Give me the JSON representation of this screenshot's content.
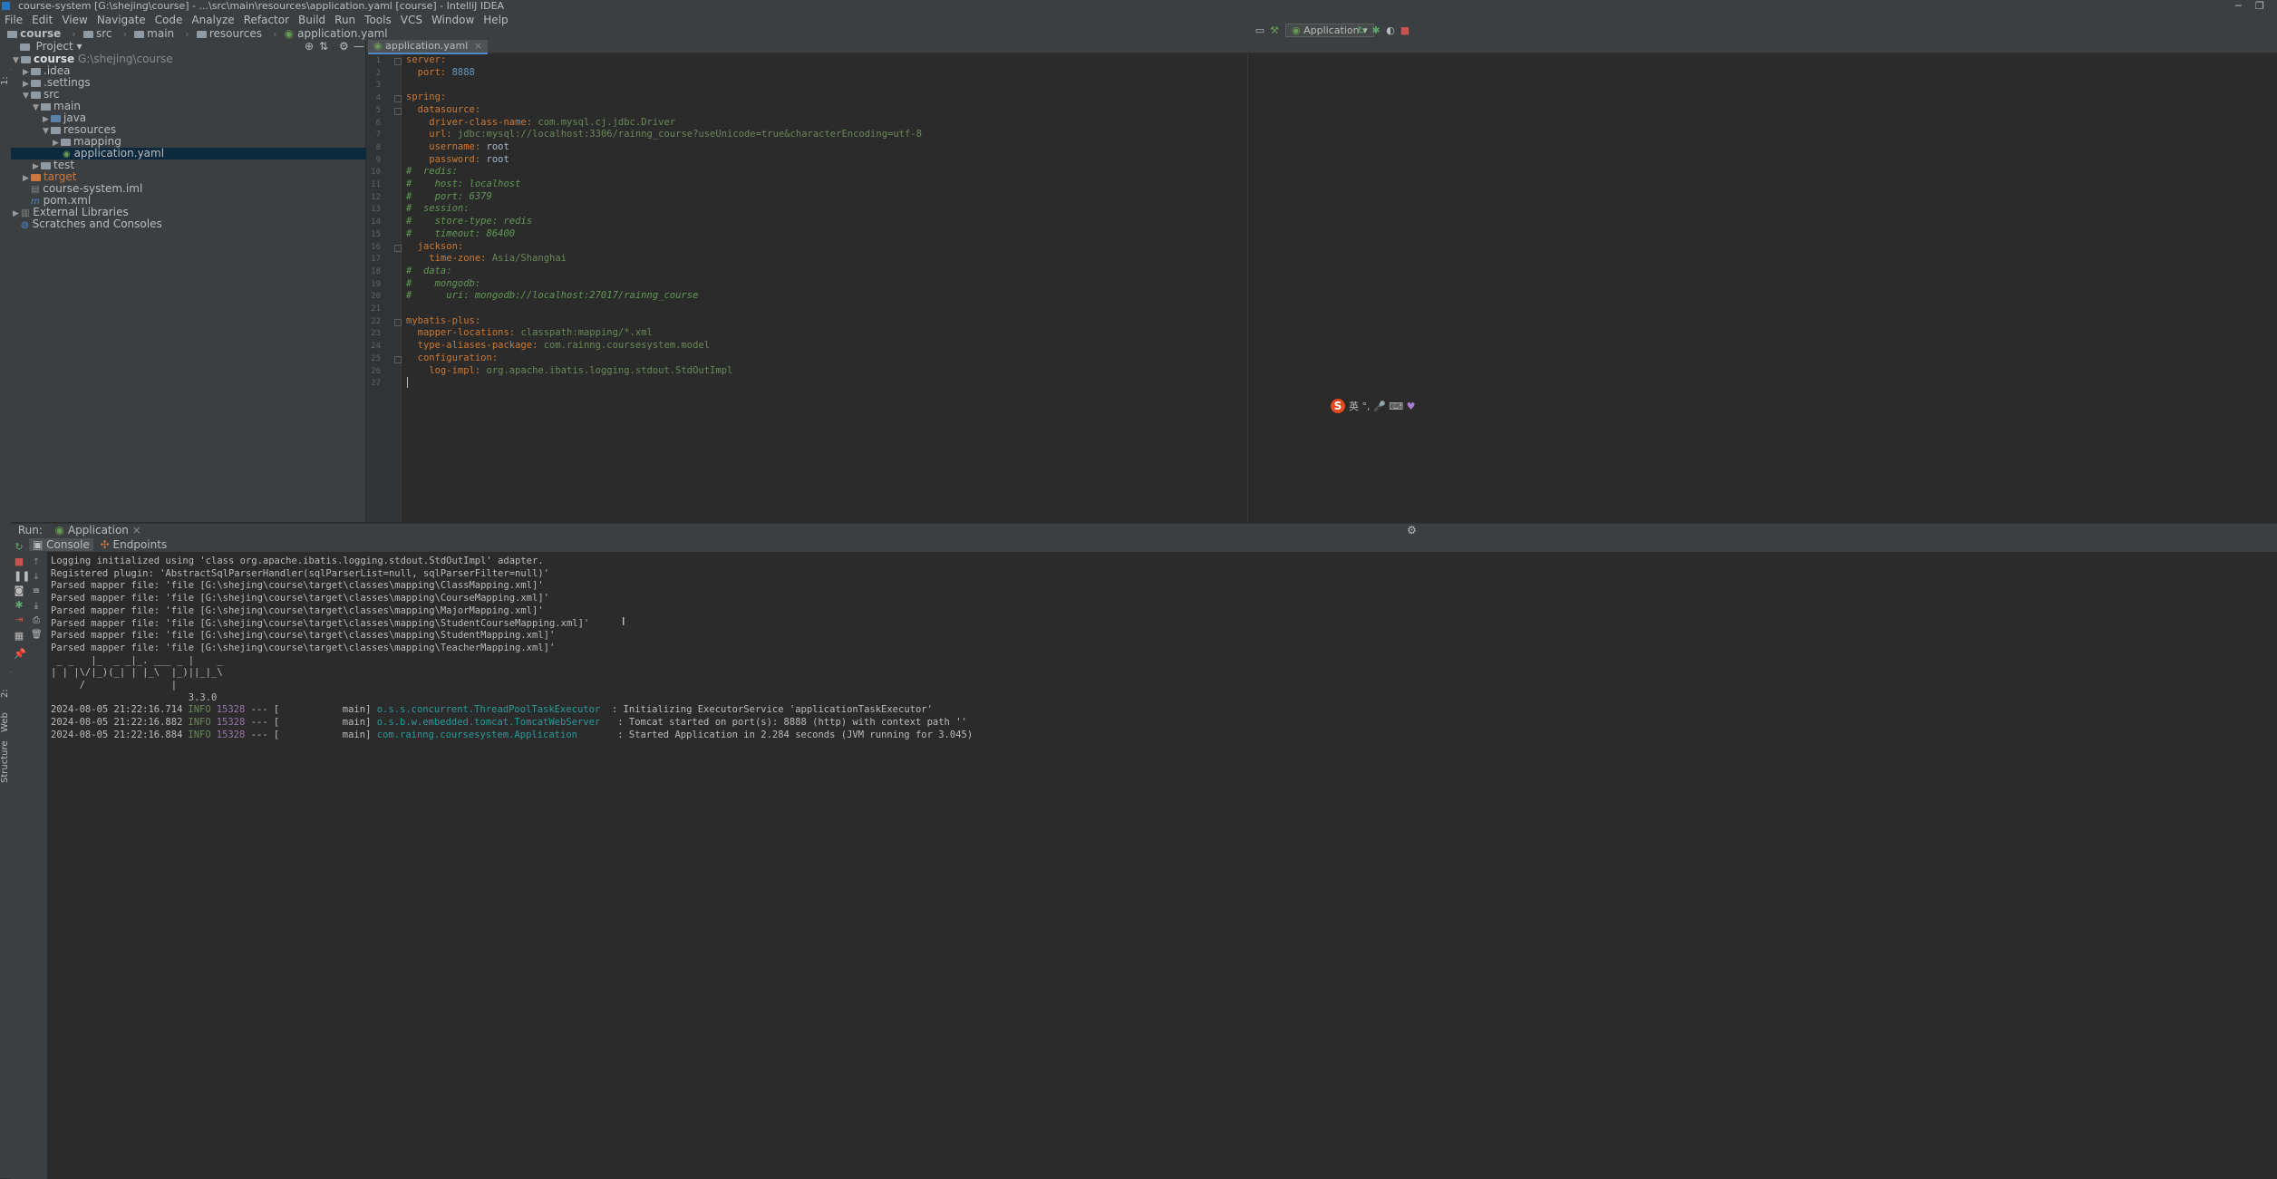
{
  "window": {
    "title": "course-system [G:\\shejing\\course] - ...\\src\\main\\resources\\application.yaml [course] - IntelliJ IDEA"
  },
  "menu": [
    "File",
    "Edit",
    "View",
    "Navigate",
    "Code",
    "Analyze",
    "Refactor",
    "Build",
    "Run",
    "Tools",
    "VCS",
    "Window",
    "Help"
  ],
  "breadcrumb": [
    "course",
    "src",
    "main",
    "resources",
    "application.yaml"
  ],
  "toolbar": {
    "run_config": "Application"
  },
  "side_tabs": {
    "project": "1: Project",
    "favorites": "2: Favorites",
    "web": "Web",
    "structure": "Structure"
  },
  "project": {
    "header": "Project",
    "tree": [
      {
        "label": "course",
        "extra": "G:\\shejing\\course"
      },
      {
        "label": ".idea"
      },
      {
        "label": ".settings"
      },
      {
        "label": "src"
      },
      {
        "label": "main"
      },
      {
        "label": "java"
      },
      {
        "label": "resources"
      },
      {
        "label": "mapping"
      },
      {
        "label": "application.yaml"
      },
      {
        "label": "test"
      },
      {
        "label": "target"
      },
      {
        "label": "course-system.iml"
      },
      {
        "label": "pom.xml"
      },
      {
        "label": "External Libraries"
      },
      {
        "label": "Scratches and Consoles"
      }
    ]
  },
  "editor": {
    "tab": "application.yaml",
    "line_numbers": [
      "1",
      "2",
      "3",
      "4",
      "5",
      "6",
      "7",
      "8",
      "9",
      "10",
      "11",
      "12",
      "13",
      "14",
      "15",
      "16",
      "17",
      "18",
      "19",
      "20",
      "21",
      "22",
      "23",
      "24",
      "25",
      "26",
      "27"
    ],
    "lines": [
      {
        "k": "server:",
        "v": ""
      },
      {
        "k": "  port: ",
        "v": "8888"
      },
      {
        "k": "",
        "v": ""
      },
      {
        "k": "spring:",
        "v": ""
      },
      {
        "k": "  datasource:",
        "v": ""
      },
      {
        "k": "    driver-class-name: ",
        "v": "com.mysql.cj.jdbc.Driver"
      },
      {
        "k": "    url: ",
        "v": "jdbc:mysql://localhost:3306/rainng_course?useUnicode=true&characterEncoding=utf-8"
      },
      {
        "k": "    username: ",
        "v": "root"
      },
      {
        "k": "    password: ",
        "v": "root"
      },
      {
        "c": "#  redis:"
      },
      {
        "c": "#    host: localhost"
      },
      {
        "c": "#    port: 6379"
      },
      {
        "c": "#  session:"
      },
      {
        "c": "#    store-type: redis"
      },
      {
        "c": "#    timeout: 86400"
      },
      {
        "k": "  jackson:",
        "v": ""
      },
      {
        "k": "    time-zone: ",
        "v": "Asia/Shanghai"
      },
      {
        "c": "#  data:"
      },
      {
        "c": "#    mongodb:"
      },
      {
        "c": "#      uri: mongodb://localhost:27017/rainng_course"
      },
      {
        "k": "",
        "v": ""
      },
      {
        "k": "mybatis-plus:",
        "v": ""
      },
      {
        "k": "  mapper-locations: ",
        "v": "classpath:mapping/*.xml"
      },
      {
        "k": "  type-aliases-package: ",
        "v": "com.rainng.coursesystem.model"
      },
      {
        "k": "  configuration:",
        "v": ""
      },
      {
        "k": "    log-impl: ",
        "v": "org.apache.ibatis.logging.stdout.StdOutImpl"
      },
      {
        "k": "",
        "v": ""
      }
    ]
  },
  "ime": {
    "lang": "英"
  },
  "run": {
    "label": "Run:",
    "tab": "Application",
    "console_tab": "Console",
    "endpoints_tab": "Endpoints",
    "lines": [
      "Logging initialized using 'class org.apache.ibatis.logging.stdout.StdOutImpl' adapter.",
      "Registered plugin: 'AbstractSqlParserHandler(sqlParserList=null, sqlParserFilter=null)'",
      "Parsed mapper file: 'file [G:\\shejing\\course\\target\\classes\\mapping\\ClassMapping.xml]'",
      "Parsed mapper file: 'file [G:\\shejing\\course\\target\\classes\\mapping\\CourseMapping.xml]'",
      "Parsed mapper file: 'file [G:\\shejing\\course\\target\\classes\\mapping\\MajorMapping.xml]'",
      "Parsed mapper file: 'file [G:\\shejing\\course\\target\\classes\\mapping\\StudentCourseMapping.xml]'",
      "Parsed mapper file: 'file [G:\\shejing\\course\\target\\classes\\mapping\\StudentMapping.xml]'",
      "Parsed mapper file: 'file [G:\\shejing\\course\\target\\classes\\mapping\\TeacherMapping.xml]'",
      " _ _   |_  _ _|_. ___ _ |    _ ",
      "| | |\\/|_)(_| | |_\\  |_)||_|_\\ ",
      "     /               |         ",
      "                        3.3.0 "
    ],
    "log": [
      {
        "ts": "2024-08-05 21:22:16.714",
        "lvl": "INFO",
        "pid": "15328",
        "mid": " --- [           main] ",
        "logger": "o.s.s.concurrent.ThreadPoolTaskExecutor ",
        "msg": " : Initializing ExecutorService 'applicationTaskExecutor'"
      },
      {
        "ts": "2024-08-05 21:22:16.882",
        "lvl": "INFO",
        "pid": "15328",
        "mid": " --- [           main] ",
        "logger": "o.s.b.w.embedded.tomcat.TomcatWebServer  ",
        "msg": " : Tomcat started on port(s): 8888 (http) with context path ''"
      },
      {
        "ts": "2024-08-05 21:22:16.884",
        "lvl": "INFO",
        "pid": "15328",
        "mid": " --- [           main] ",
        "logger": "com.rainng.coursesystem.Application      ",
        "msg": " : Started Application in 2.284 seconds (JVM running for 3.045)"
      }
    ]
  }
}
